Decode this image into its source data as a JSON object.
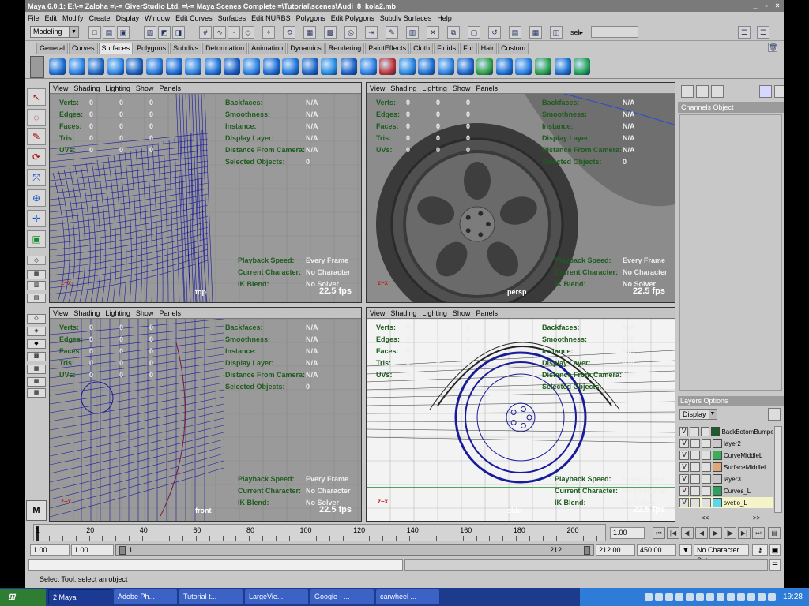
{
  "window": {
    "title": "Maya 6.0.1: E:\\-= Zaloha =\\-= GiverStudio Ltd. =\\-= Maya Scenes Complete =\\Tutorial\\scenes\\Audi_8_kola2.mb",
    "min": "_",
    "max": "▫",
    "close": "×"
  },
  "menubar": [
    "File",
    "Edit",
    "Modify",
    "Create",
    "Display",
    "Window",
    "Edit Curves",
    "Surfaces",
    "Edit NURBS",
    "Polygons",
    "Edit Polygons",
    "Subdiv Surfaces",
    "Help"
  ],
  "status_line": {
    "mode": "Modeling",
    "sel_label": "sel▸"
  },
  "shelf_tabs": [
    "General",
    "Curves",
    "Surfaces",
    "Polygons",
    "Subdivs",
    "Deformation",
    "Animation",
    "Dynamics",
    "Rendering",
    "PaintEffects",
    "Cloth",
    "Fluids",
    "Fur",
    "Hair",
    "Custom"
  ],
  "active_shelf_tab": "Surfaces",
  "viewport_menu": [
    "View",
    "Shading",
    "Lighting",
    "Show",
    "Panels"
  ],
  "hud": {
    "left_labels": [
      "Verts:",
      "Edges:",
      "Faces:",
      "Tris:",
      "UVs:"
    ],
    "left_values": [
      "0",
      "0",
      "0"
    ],
    "right_labels": [
      "Backfaces:",
      "Smoothness:",
      "Instance:",
      "Display Layer:",
      "Distance From Camera:",
      "Selected Objects:"
    ],
    "right_values": [
      "N/A",
      "N/A",
      "N/A",
      "N/A",
      "N/A",
      "0"
    ],
    "bottom_labels": [
      "Playback Speed:",
      "Current Character:",
      "IK Blend:"
    ],
    "bottom_values": [
      "Every Frame",
      "No Character",
      "No Solver"
    ]
  },
  "viewports": [
    {
      "camera": "top",
      "fps": "22.5 fps",
      "axis": "z−x"
    },
    {
      "camera": "persp",
      "fps": "22.5 fps",
      "axis": "z−x"
    },
    {
      "camera": "front",
      "fps": "22.5 fps",
      "axis": "z−x"
    },
    {
      "camera": "side",
      "fps": "22.5 fps",
      "axis": "z−x"
    }
  ],
  "channel_box": {
    "header": "Channels  Object"
  },
  "layers": {
    "header": "Layers  Options",
    "display_select": "Display",
    "items": [
      {
        "v": "V",
        "name": "BackBotomBumper",
        "color": "#1f5c2a",
        "selected": false
      },
      {
        "v": "V",
        "name": "layer2",
        "color": "#c8c8c8",
        "selected": false
      },
      {
        "v": "V",
        "name": "CurveMiddleL",
        "color": "#3cae5a",
        "selected": false
      },
      {
        "v": "V",
        "name": "SurfaceMiddleL",
        "color": "#e0a878",
        "selected": false
      },
      {
        "v": "V",
        "name": "layer3",
        "color": "#c8c8c8",
        "selected": false
      },
      {
        "v": "V",
        "name": "Curves_L",
        "color": "#2f9f5a",
        "selected": false
      },
      {
        "v": "V",
        "name": "svetlo_L",
        "color": "#5ad8ea",
        "selected": true
      }
    ],
    "nav_left": "<<",
    "nav_right": ">>"
  },
  "time_slider": {
    "ticks": [
      "1",
      "20",
      "40",
      "60",
      "80",
      "100",
      "120",
      "140",
      "160",
      "180",
      "200"
    ],
    "current_time": "1.00"
  },
  "range_slider": {
    "start": "1.00",
    "inner_start": "1.00",
    "range_left": "1",
    "range_right": "212",
    "end_inner": "212.00",
    "end": "450.00",
    "character": "No Character Set"
  },
  "help_line": "Select Tool: select an object",
  "taskbar": {
    "items": [
      "2 Maya",
      "Adobe Ph...",
      "Tutorial t...",
      "LargeVie...",
      "Google - ...",
      "carwheel ..."
    ],
    "clock": "19:28"
  }
}
